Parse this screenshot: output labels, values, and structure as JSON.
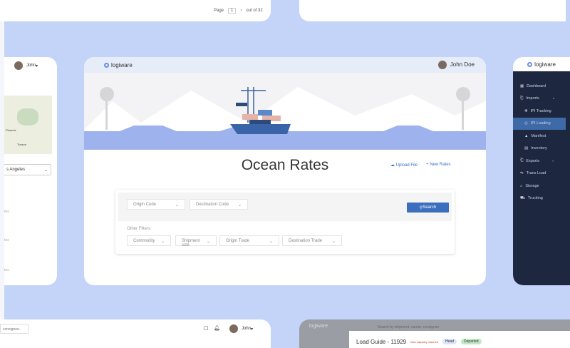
{
  "top_left": {
    "page_label": "Page",
    "page_value": "1",
    "out_of": "out of 32"
  },
  "left_card": {
    "user": "John",
    "location": "s Angeles",
    "map_labels": [
      "Phoenix",
      "Tucson"
    ],
    "row_label": "tes"
  },
  "main": {
    "brand": "logiware",
    "user": "John Doe",
    "title": "Ocean Rates",
    "upload": "Upload File",
    "new_rates": "+ New Rates",
    "origin": "Origin Code",
    "destination": "Destination Code",
    "search": "Search",
    "other_filters": "Other Filters",
    "filters": [
      "Commodity",
      "Shipment size",
      "Origin Trade",
      "Destination Trade"
    ]
  },
  "right_card": {
    "brand": "logiware",
    "menu": [
      {
        "label": "Dashboard",
        "icon": "dashboard-icon"
      },
      {
        "label": "Imports",
        "icon": "imports-icon"
      },
      {
        "label": "IPI Tracking",
        "icon": "tracking-icon"
      },
      {
        "label": "IPI Loading",
        "icon": "loading-icon"
      },
      {
        "label": "Manifest",
        "icon": "manifest-icon"
      },
      {
        "label": "Inventory",
        "icon": "inventory-icon"
      },
      {
        "label": "Exports",
        "icon": "exports-icon"
      },
      {
        "label": "Trans Load",
        "icon": "trans-load-icon"
      },
      {
        "label": "Storage",
        "icon": "storage-icon"
      },
      {
        "label": "Trucking",
        "icon": "trucking-icon"
      }
    ]
  },
  "bottom_left": {
    "search_value": "consignee..",
    "user": "John"
  },
  "bottom_right": {
    "brand": "logiware",
    "search_placeholder": "Search by shipment, carrier, consignee",
    "title": "Load Guide - 11929",
    "warning": "Max capacity reached",
    "badge1": "Head",
    "badge2": "Departed"
  },
  "colors": {
    "background": "#c3d4f8",
    "accent": "#3b6fbd",
    "sidebar": "#1e2740"
  }
}
